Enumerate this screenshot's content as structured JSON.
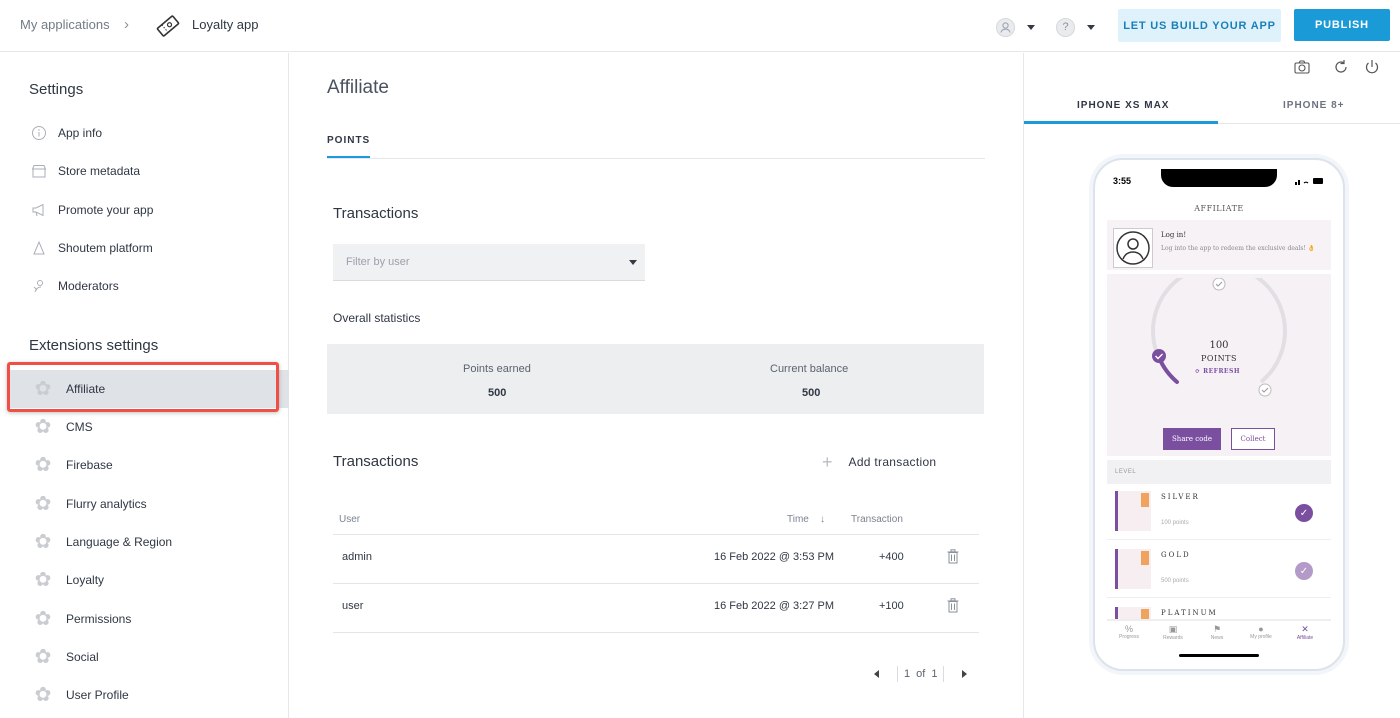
{
  "header": {
    "breadcrumb_root": "My applications",
    "breadcrumb_app": "Loyalty app",
    "build_button": "LET US BUILD YOUR APP",
    "publish_button": "PUBLISH"
  },
  "sidebar": {
    "settings_heading": "Settings",
    "settings_items": [
      {
        "label": "App info",
        "icon": "info-icon"
      },
      {
        "label": "Store metadata",
        "icon": "store-icon"
      },
      {
        "label": "Promote your app",
        "icon": "megaphone-icon"
      },
      {
        "label": "Shoutem platform",
        "icon": "platform-icon"
      },
      {
        "label": "Moderators",
        "icon": "moderators-icon"
      }
    ],
    "extensions_heading": "Extensions settings",
    "extension_items": [
      {
        "label": "Affiliate",
        "active": true
      },
      {
        "label": "CMS"
      },
      {
        "label": "Firebase"
      },
      {
        "label": "Flurry analytics"
      },
      {
        "label": "Language & Region"
      },
      {
        "label": "Loyalty"
      },
      {
        "label": "Permissions"
      },
      {
        "label": "Social"
      },
      {
        "label": "User Profile"
      }
    ]
  },
  "main": {
    "title": "Affiliate",
    "tab": "POINTS",
    "transactions_heading": "Transactions",
    "filter_placeholder": "Filter by user",
    "overall_heading": "Overall statistics",
    "stats": {
      "earned_label": "Points earned",
      "earned_value": "500",
      "balance_label": "Current balance",
      "balance_value": "500"
    },
    "transactions_heading2": "Transactions",
    "add_transaction": "Add transaction",
    "columns": {
      "user": "User",
      "time": "Time",
      "time_sort": "↓",
      "transaction": "Transaction"
    },
    "rows": [
      {
        "user": "admin",
        "time": "16 Feb 2022 @ 3:53 PM",
        "amount": "+400"
      },
      {
        "user": "user",
        "time": "16 Feb 2022 @ 3:27 PM",
        "amount": "+100"
      }
    ],
    "pager": {
      "page": "1",
      "of": "of",
      "total": "1"
    }
  },
  "preview": {
    "device_tabs": [
      "IPHONE XS MAX",
      "IPHONE 8+"
    ],
    "active_device": "IPHONE XS MAX",
    "phone": {
      "time": "3:55",
      "screen_title": "AFFILIATE",
      "login_title": "Log in!",
      "login_sub": "Log into the app to redeem the exclusive deals! 👌",
      "points_value": "100",
      "points_label": "POINTS",
      "refresh": "REFRESH",
      "share_button": "Share code",
      "collect_button": "Collect",
      "levels_heading": "LEVEL",
      "levels": [
        {
          "name": "SILVER",
          "points": "100 points",
          "check_color": "#7b4fa0"
        },
        {
          "name": "GOLD",
          "points": "500 points",
          "check_color": "#b49ac9"
        },
        {
          "name": "PLATINUM",
          "points": ""
        }
      ],
      "nav": [
        "Progress",
        "Rewards",
        "News",
        "My profile",
        "Affiliate"
      ]
    },
    "accent_color": "#1a9ad6"
  }
}
